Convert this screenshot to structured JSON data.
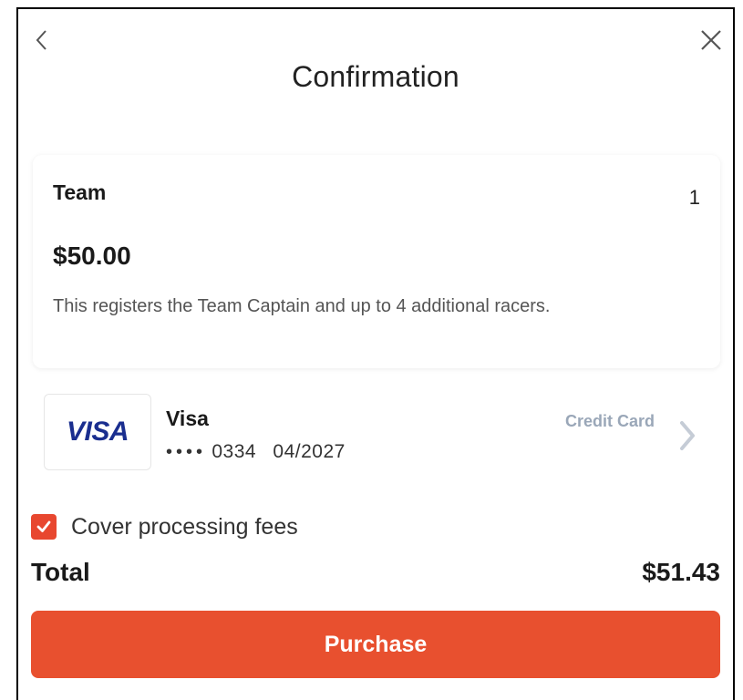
{
  "header": {
    "title": "Confirmation"
  },
  "item": {
    "name": "Team",
    "quantity": "1",
    "price": "$50.00",
    "description": "This registers the Team Captain and up to 4 additional racers."
  },
  "payment": {
    "logo_text": "VISA",
    "brand": "Visa",
    "masked_number": "••••",
    "last4": "0334",
    "expiry": "04/2027",
    "type_label": "Credit Card"
  },
  "fees": {
    "label": "Cover processing fees",
    "checked": true
  },
  "summary": {
    "total_label": "Total",
    "total_value": "$51.43"
  },
  "actions": {
    "purchase_label": "Purchase"
  },
  "colors": {
    "accent": "#e8502f",
    "visa_blue": "#1a2e8f",
    "muted": "#9aa7b8"
  }
}
